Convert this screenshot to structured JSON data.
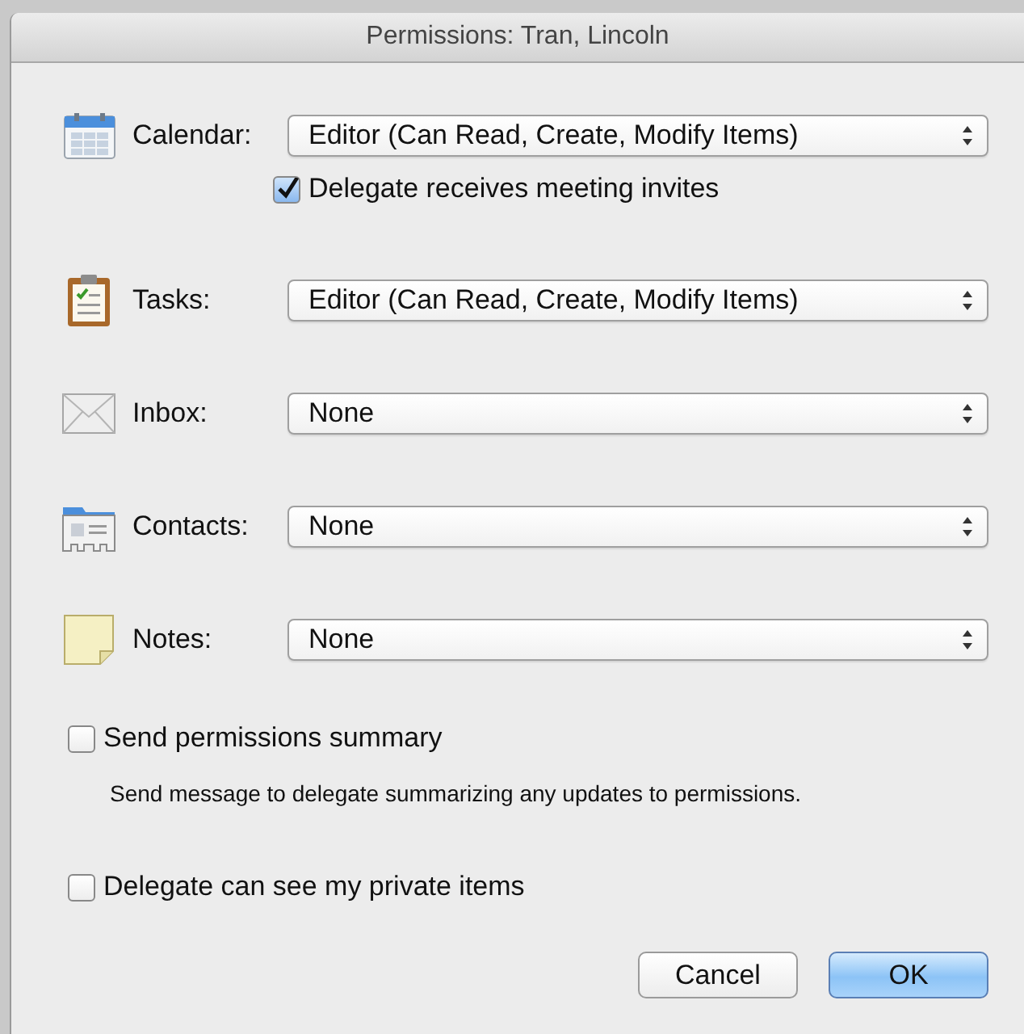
{
  "window": {
    "title": "Permissions: Tran, Lincoln"
  },
  "folders": [
    {
      "kind": "calendar",
      "label": "Calendar:",
      "permission": "Editor (Can Read, Create, Modify Items)",
      "option": {
        "label": "Delegate receives meeting invites",
        "checked": true
      }
    },
    {
      "kind": "tasks",
      "label": "Tasks:",
      "permission": "Editor (Can Read, Create, Modify Items)"
    },
    {
      "kind": "inbox",
      "label": "Inbox:",
      "permission": "None"
    },
    {
      "kind": "contacts",
      "label": "Contacts:",
      "permission": "None"
    },
    {
      "kind": "notes",
      "label": "Notes:",
      "permission": "None"
    }
  ],
  "summary": {
    "label": "Send permissions summary",
    "checked": false,
    "description": "Send message to delegate summarizing any updates to permissions."
  },
  "private_items": {
    "label": "Delegate can see my private items",
    "checked": false
  },
  "buttons": [
    {
      "label": "Cancel",
      "default": false
    },
    {
      "label": "OK",
      "default": true
    }
  ]
}
